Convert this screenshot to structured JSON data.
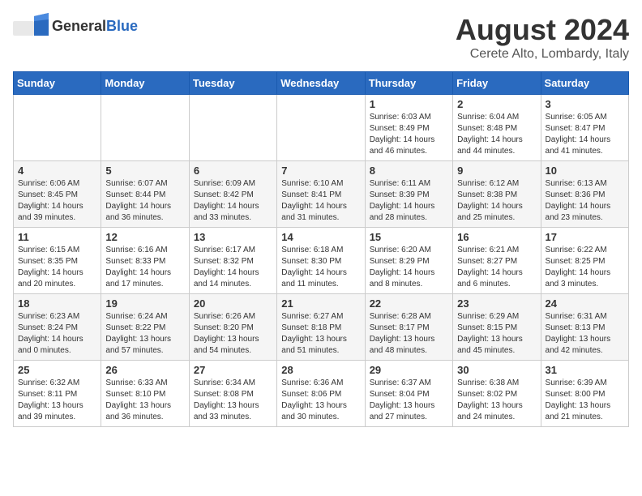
{
  "logo": {
    "general": "General",
    "blue": "Blue"
  },
  "title": "August 2024",
  "location": "Cerete Alto, Lombardy, Italy",
  "days_of_week": [
    "Sunday",
    "Monday",
    "Tuesday",
    "Wednesday",
    "Thursday",
    "Friday",
    "Saturday"
  ],
  "weeks": [
    [
      {
        "day": "",
        "info": ""
      },
      {
        "day": "",
        "info": ""
      },
      {
        "day": "",
        "info": ""
      },
      {
        "day": "",
        "info": ""
      },
      {
        "day": "1",
        "info": "Sunrise: 6:03 AM\nSunset: 8:49 PM\nDaylight: 14 hours\nand 46 minutes."
      },
      {
        "day": "2",
        "info": "Sunrise: 6:04 AM\nSunset: 8:48 PM\nDaylight: 14 hours\nand 44 minutes."
      },
      {
        "day": "3",
        "info": "Sunrise: 6:05 AM\nSunset: 8:47 PM\nDaylight: 14 hours\nand 41 minutes."
      }
    ],
    [
      {
        "day": "4",
        "info": "Sunrise: 6:06 AM\nSunset: 8:45 PM\nDaylight: 14 hours\nand 39 minutes."
      },
      {
        "day": "5",
        "info": "Sunrise: 6:07 AM\nSunset: 8:44 PM\nDaylight: 14 hours\nand 36 minutes."
      },
      {
        "day": "6",
        "info": "Sunrise: 6:09 AM\nSunset: 8:42 PM\nDaylight: 14 hours\nand 33 minutes."
      },
      {
        "day": "7",
        "info": "Sunrise: 6:10 AM\nSunset: 8:41 PM\nDaylight: 14 hours\nand 31 minutes."
      },
      {
        "day": "8",
        "info": "Sunrise: 6:11 AM\nSunset: 8:39 PM\nDaylight: 14 hours\nand 28 minutes."
      },
      {
        "day": "9",
        "info": "Sunrise: 6:12 AM\nSunset: 8:38 PM\nDaylight: 14 hours\nand 25 minutes."
      },
      {
        "day": "10",
        "info": "Sunrise: 6:13 AM\nSunset: 8:36 PM\nDaylight: 14 hours\nand 23 minutes."
      }
    ],
    [
      {
        "day": "11",
        "info": "Sunrise: 6:15 AM\nSunset: 8:35 PM\nDaylight: 14 hours\nand 20 minutes."
      },
      {
        "day": "12",
        "info": "Sunrise: 6:16 AM\nSunset: 8:33 PM\nDaylight: 14 hours\nand 17 minutes."
      },
      {
        "day": "13",
        "info": "Sunrise: 6:17 AM\nSunset: 8:32 PM\nDaylight: 14 hours\nand 14 minutes."
      },
      {
        "day": "14",
        "info": "Sunrise: 6:18 AM\nSunset: 8:30 PM\nDaylight: 14 hours\nand 11 minutes."
      },
      {
        "day": "15",
        "info": "Sunrise: 6:20 AM\nSunset: 8:29 PM\nDaylight: 14 hours\nand 8 minutes."
      },
      {
        "day": "16",
        "info": "Sunrise: 6:21 AM\nSunset: 8:27 PM\nDaylight: 14 hours\nand 6 minutes."
      },
      {
        "day": "17",
        "info": "Sunrise: 6:22 AM\nSunset: 8:25 PM\nDaylight: 14 hours\nand 3 minutes."
      }
    ],
    [
      {
        "day": "18",
        "info": "Sunrise: 6:23 AM\nSunset: 8:24 PM\nDaylight: 14 hours\nand 0 minutes."
      },
      {
        "day": "19",
        "info": "Sunrise: 6:24 AM\nSunset: 8:22 PM\nDaylight: 13 hours\nand 57 minutes."
      },
      {
        "day": "20",
        "info": "Sunrise: 6:26 AM\nSunset: 8:20 PM\nDaylight: 13 hours\nand 54 minutes."
      },
      {
        "day": "21",
        "info": "Sunrise: 6:27 AM\nSunset: 8:18 PM\nDaylight: 13 hours\nand 51 minutes."
      },
      {
        "day": "22",
        "info": "Sunrise: 6:28 AM\nSunset: 8:17 PM\nDaylight: 13 hours\nand 48 minutes."
      },
      {
        "day": "23",
        "info": "Sunrise: 6:29 AM\nSunset: 8:15 PM\nDaylight: 13 hours\nand 45 minutes."
      },
      {
        "day": "24",
        "info": "Sunrise: 6:31 AM\nSunset: 8:13 PM\nDaylight: 13 hours\nand 42 minutes."
      }
    ],
    [
      {
        "day": "25",
        "info": "Sunrise: 6:32 AM\nSunset: 8:11 PM\nDaylight: 13 hours\nand 39 minutes."
      },
      {
        "day": "26",
        "info": "Sunrise: 6:33 AM\nSunset: 8:10 PM\nDaylight: 13 hours\nand 36 minutes."
      },
      {
        "day": "27",
        "info": "Sunrise: 6:34 AM\nSunset: 8:08 PM\nDaylight: 13 hours\nand 33 minutes."
      },
      {
        "day": "28",
        "info": "Sunrise: 6:36 AM\nSunset: 8:06 PM\nDaylight: 13 hours\nand 30 minutes."
      },
      {
        "day": "29",
        "info": "Sunrise: 6:37 AM\nSunset: 8:04 PM\nDaylight: 13 hours\nand 27 minutes."
      },
      {
        "day": "30",
        "info": "Sunrise: 6:38 AM\nSunset: 8:02 PM\nDaylight: 13 hours\nand 24 minutes."
      },
      {
        "day": "31",
        "info": "Sunrise: 6:39 AM\nSunset: 8:00 PM\nDaylight: 13 hours\nand 21 minutes."
      }
    ]
  ]
}
